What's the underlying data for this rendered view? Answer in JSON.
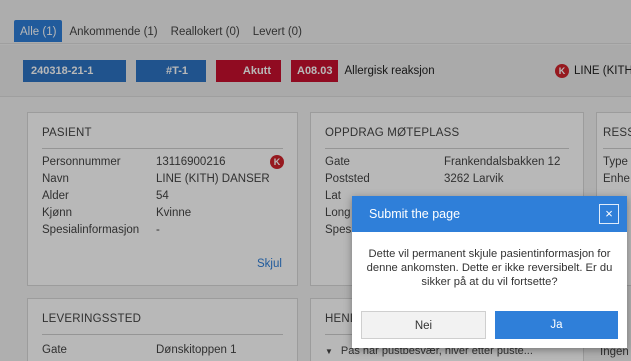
{
  "tabs": [
    {
      "label": "Alle (1)"
    },
    {
      "label": "Ankommende (1)"
    },
    {
      "label": "Reallokert (0)"
    },
    {
      "label": "Levert (0)"
    }
  ],
  "header": {
    "case_id": "240318-21-1",
    "unit": "#T-1",
    "priority": "Akutt",
    "code": "A08.03",
    "reaction": "Allergisk reaksjon",
    "right_text": "LINE (KITH"
  },
  "patient": {
    "title": "PASIENT",
    "rows": [
      {
        "key": "Personnummer",
        "value": "13116900216"
      },
      {
        "key": "Navn",
        "value": "LINE (KITH) DANSER"
      },
      {
        "key": "Alder",
        "value": "54"
      },
      {
        "key": "Kjønn",
        "value": "Kvinne"
      },
      {
        "key": "Spesialinformasjon",
        "value": "-"
      }
    ],
    "hide_link": "Skjul"
  },
  "assignment": {
    "title": "OPPDRAG MØTEPLASS",
    "rows": [
      {
        "key": "Gate",
        "value": "Frankendalsbakken 12"
      },
      {
        "key": "Poststed",
        "value": "3262 Larvik"
      },
      {
        "key": "Lat",
        "value": ""
      },
      {
        "key": "Long",
        "value": ""
      },
      {
        "key": "Spesi",
        "value": ""
      }
    ]
  },
  "resources": {
    "title": "RESS",
    "rows": [
      {
        "key": "Type",
        "value": ""
      },
      {
        "key": "Enhe",
        "value": ""
      }
    ]
  },
  "delivery": {
    "title": "LEVERINGSSTED",
    "rows": [
      {
        "key": "Gate",
        "value": "Dønskitoppen 1"
      }
    ]
  },
  "events": {
    "title": "HEND",
    "bullet": "Pas har pustbesvær, hiver etter puste...",
    "right_text": "Ingen"
  },
  "dialog": {
    "title": "Submit the page",
    "close": "×",
    "message": "Dette vil permanent skjule pasientinformasjon for denne ankomsten. Dette er ikke reversibelt. Er du sikker på at du vil fortsette?",
    "no_label": "Nei",
    "yes_label": "Ja"
  },
  "badge_icon": "K",
  "colors": {
    "primary": "#2f7fd9",
    "chip_blue": "#2d74c4",
    "chip_red": "#c8102e",
    "k_icon": "#d0232b"
  }
}
